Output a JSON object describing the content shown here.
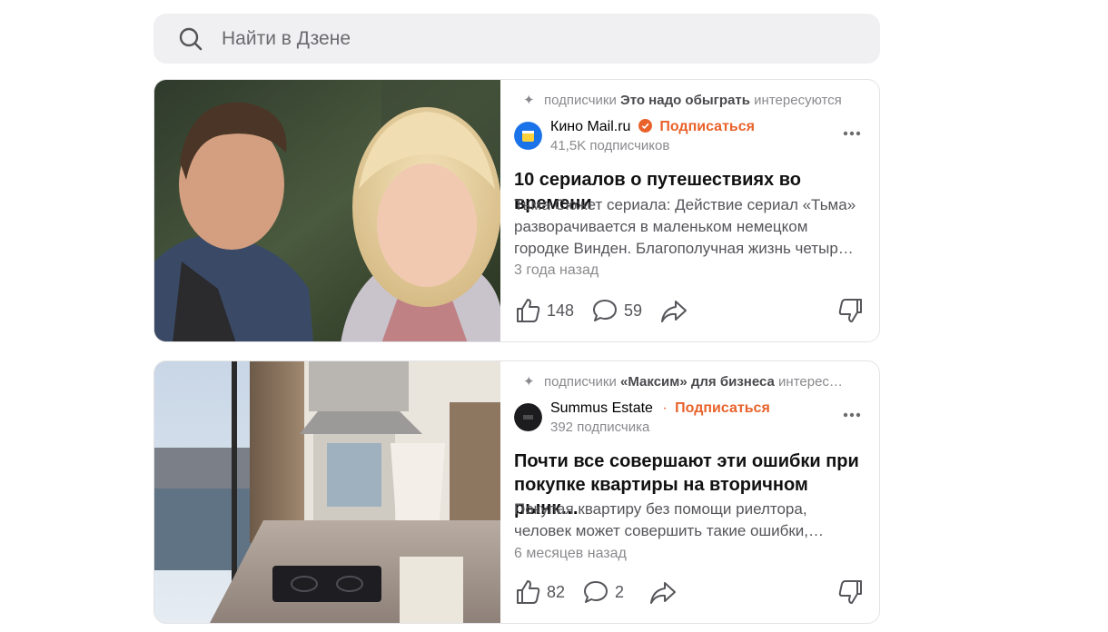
{
  "search": {
    "placeholder": "Найти в Дзене"
  },
  "cards": [
    {
      "reason_prefix": "подписчики",
      "reason_channel": "Это надо обыграть",
      "reason_suffix": "интересуются",
      "channel_name": "Кино Mail.ru",
      "verified": true,
      "subscribe_label": "Подписаться",
      "subscribers": "41,5K подписчиков",
      "title": "10 сериалов о путешествиях во времени",
      "excerpt_lines": [
        "Тьма Сюжет сериала: Действие сериал «Тьма»",
        "разворачивается в маленьком немецком",
        "городке Винден. Благополучная жизнь четыр…"
      ],
      "date": "3 года назад",
      "likes": "148",
      "comments": "59"
    },
    {
      "reason_prefix": "подписчики",
      "reason_channel": "«Максим» для бизнеса",
      "reason_suffix": "интерес…",
      "channel_name": "Summus Estate",
      "verified": false,
      "subscribe_label": "Подписаться",
      "subscribers": "392 подписчика",
      "title_lines": [
        "Почти все совершают эти ошибки при",
        "покупке квартиры на вторичном рынк…"
      ],
      "excerpt_lines": [
        "Покупая квартиру без помощи риелтора,",
        "человек может совершить такие ошибки,…"
      ],
      "date": "6 месяцев назад",
      "likes": "82",
      "comments": "2"
    }
  ],
  "colors": {
    "accent": "#e8622a",
    "muted": "#8a8a8e",
    "search_bg": "#f0f0f2"
  }
}
